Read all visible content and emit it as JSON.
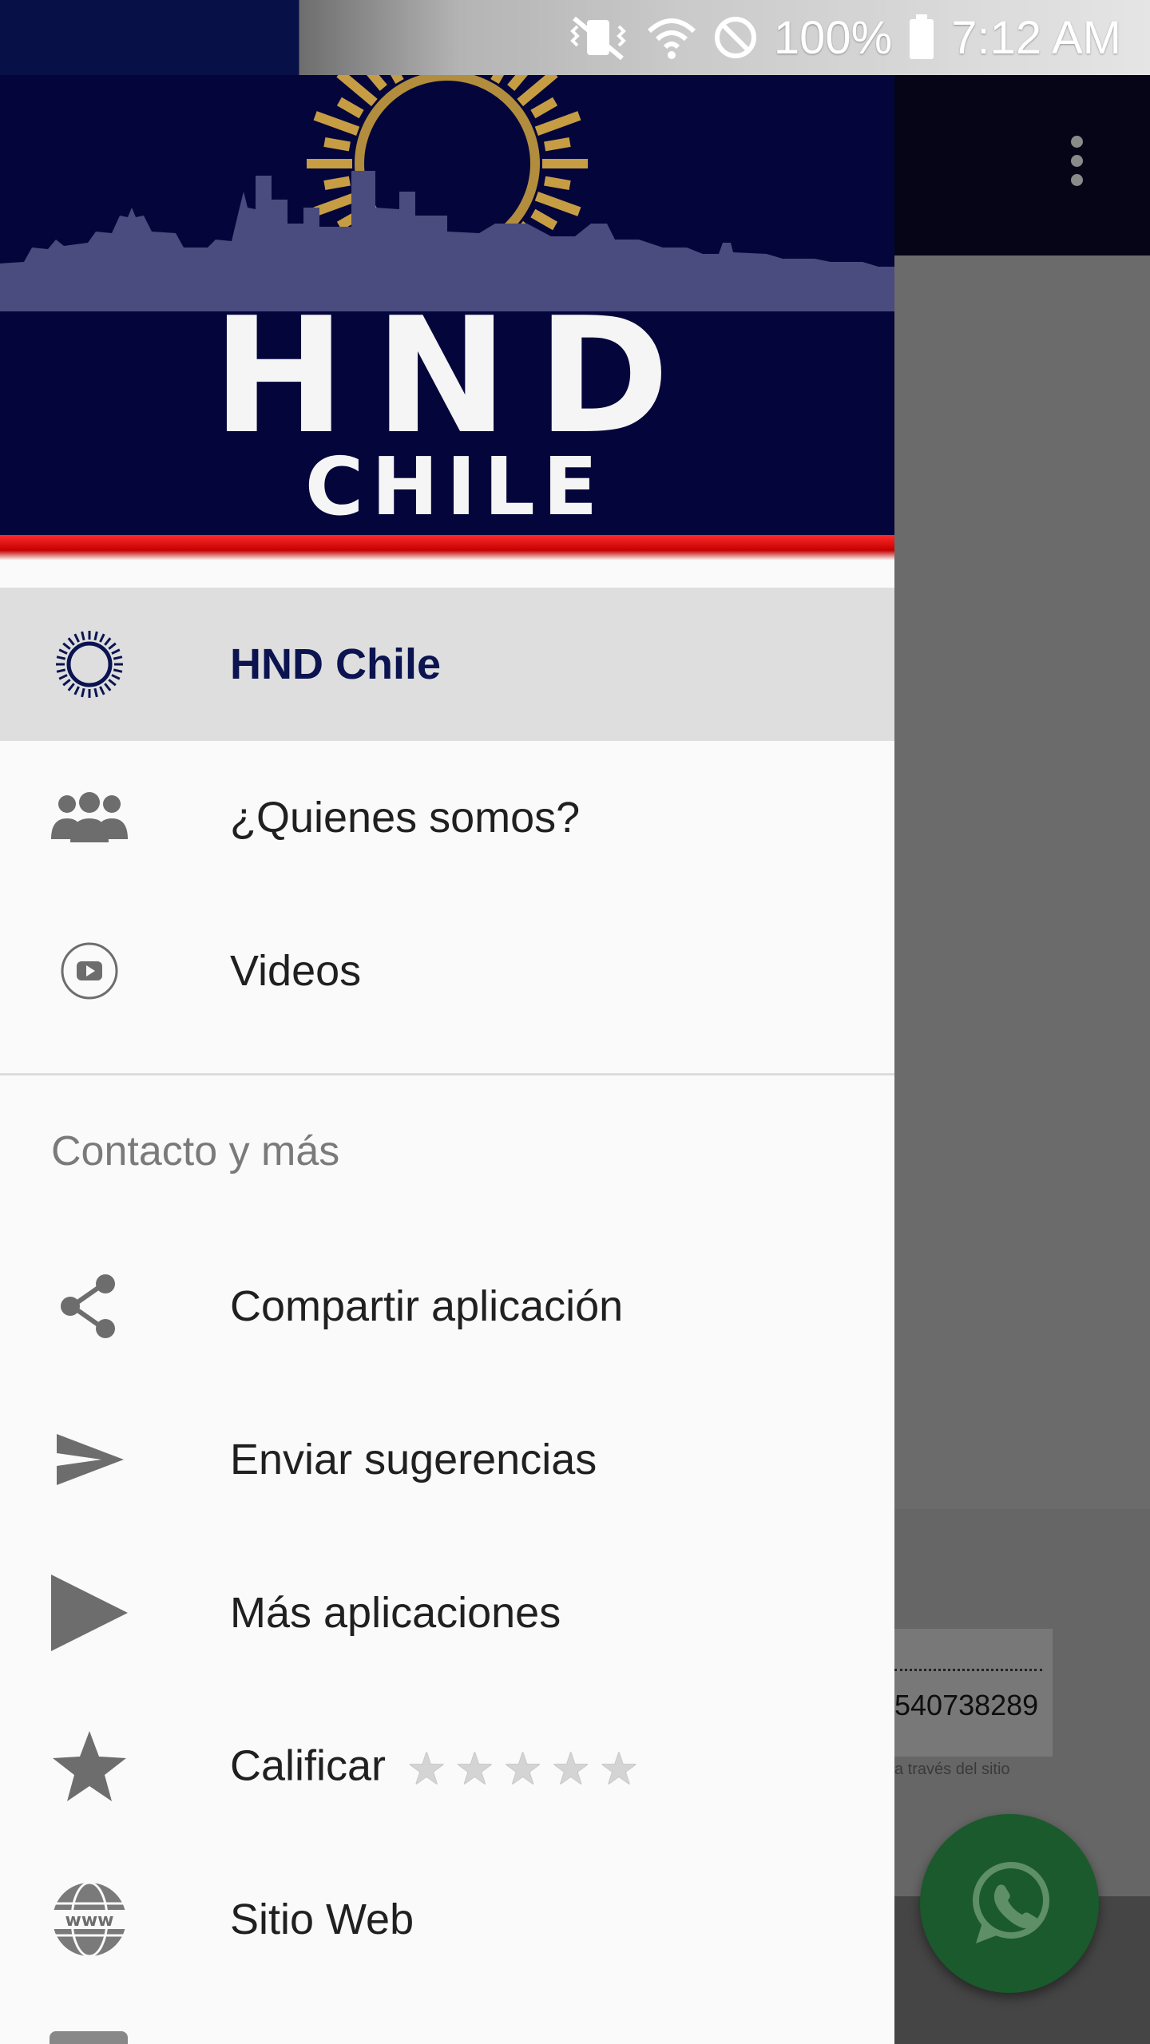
{
  "status_bar": {
    "battery": "100%",
    "time": "7:12 AM"
  },
  "drawer": {
    "header": {
      "title": "HND",
      "subtitle": "CHILE"
    },
    "items": [
      {
        "label": "HND Chile",
        "icon": "sun-logo-icon",
        "selected": true
      },
      {
        "label": "¿Quienes somos?",
        "icon": "people-icon",
        "selected": false
      },
      {
        "label": "Videos",
        "icon": "play-circle-icon",
        "selected": false
      }
    ],
    "section_title": "Contacto y más",
    "section_items": [
      {
        "label": "Compartir aplicación",
        "icon": "share-icon"
      },
      {
        "label": "Enviar sugerencias",
        "icon": "send-icon"
      },
      {
        "label": "Más aplicaciones",
        "icon": "play-store-icon"
      },
      {
        "label": "Calificar",
        "icon": "star-icon",
        "rating_stars": 5
      },
      {
        "label": "Sitio Web",
        "icon": "globe-www-icon"
      }
    ]
  },
  "background": {
    "phone": "540738289",
    "caption": "a través del sitio"
  },
  "colors": {
    "drawer_header": "#04063b",
    "selected_label": "#0b1450",
    "whatsapp_fab": "#1a5a2c"
  }
}
